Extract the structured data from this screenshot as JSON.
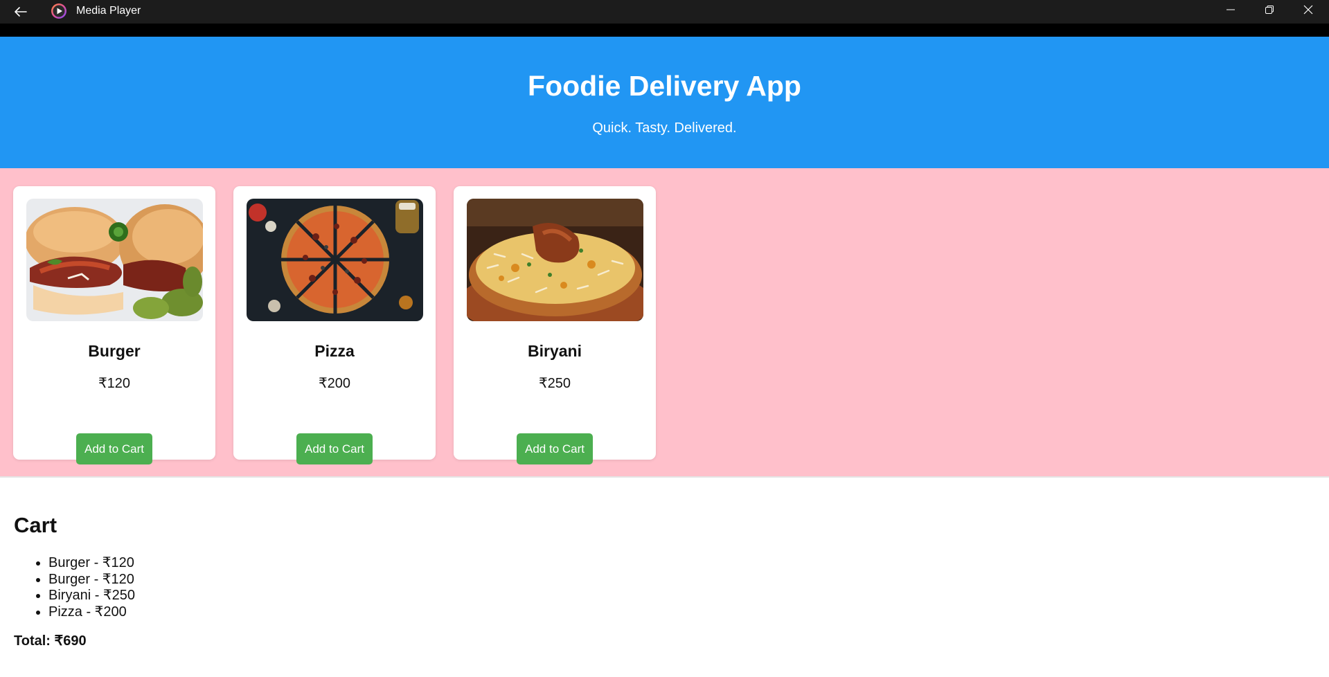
{
  "window": {
    "title": "Media Player",
    "icons": {
      "back": "back-arrow-icon",
      "logo": "media-player-logo-icon",
      "minimize": "minimize-icon",
      "maximize": "restore-icon",
      "close": "close-icon"
    }
  },
  "header": {
    "title": "Foodie Delivery App",
    "subtitle": "Quick. Tasty. Delivered."
  },
  "menu": {
    "items": [
      {
        "name": "Burger",
        "price": "₹120",
        "button": "Add to Cart",
        "image": "burger-photo"
      },
      {
        "name": "Pizza",
        "price": "₹200",
        "button": "Add to Cart",
        "image": "pizza-photo"
      },
      {
        "name": "Biryani",
        "price": "₹250",
        "button": "Add to Cart",
        "image": "biryani-photo"
      }
    ]
  },
  "cart": {
    "title": "Cart",
    "items": [
      "Burger - ₹120",
      "Burger - ₹120",
      "Biryani - ₹250",
      "Pizza - ₹200"
    ],
    "total": "Total: ₹690"
  },
  "colors": {
    "header_bg": "#2196f3",
    "menu_bg": "#ffc0cb",
    "button_bg": "#4caf50",
    "titlebar_bg": "#1c1c1c"
  }
}
